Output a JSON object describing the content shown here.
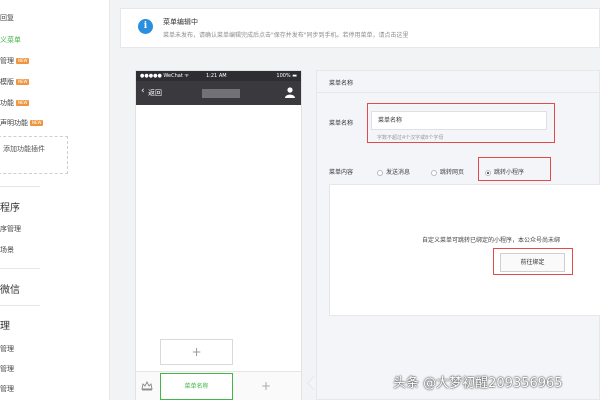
{
  "sidebar": {
    "items": [
      {
        "label": "回复",
        "active": false,
        "badge": ""
      },
      {
        "label": "义菜单",
        "active": true,
        "badge": ""
      },
      {
        "label": "管理",
        "active": false,
        "badge": "NEW"
      },
      {
        "label": "模版",
        "active": false,
        "badge": "NEW"
      },
      {
        "label": "功能",
        "active": false,
        "badge": "NEW"
      },
      {
        "label": "声明功能",
        "active": false,
        "badge": "NEW"
      }
    ],
    "plugin_label": "添加功能插件",
    "sections": [
      {
        "label": "程序",
        "items": [
          "序管理",
          "场景"
        ]
      },
      {
        "label": "微信",
        "items": []
      },
      {
        "label": "理",
        "items": [
          "管理",
          "管理",
          "管理"
        ]
      }
    ]
  },
  "info_bar": {
    "title": "菜单编辑中",
    "description": "菜单未发布，请确认菜单编辑完成后点击\"保存并发布\"同步到手机。若停用菜单，请点击这里"
  },
  "phone": {
    "carrier": "●●●●● WeChat ᯤ",
    "time": "1:21 AM",
    "battery": "100% ▬",
    "back_label": "返回",
    "menu_tab_label": "菜单名称",
    "add_sub_symbol": "+",
    "add_menu_symbol": "+"
  },
  "editor": {
    "title": "菜单名称",
    "name_label": "菜单名称",
    "name_value": "菜单名称",
    "name_hint": "字数不超过4个汉字或8个字母",
    "content_label": "菜单内容",
    "options": [
      {
        "label": "发送消息",
        "checked": false
      },
      {
        "label": "跳转网页",
        "checked": false
      },
      {
        "label": "跳转小程序",
        "checked": true
      }
    ],
    "content_note": "自定义菜单可跳转已绑定的小程序，本公众号尚未绑",
    "bind_button": "前往绑定"
  },
  "watermark": "头条 @大梦初醒209356965",
  "colors": {
    "accent_green": "#44b549",
    "info_blue": "#2b8fe0",
    "highlight_red": "#e04c4c",
    "new_badge": "#f0953f",
    "phone_header": "#3a3a3e"
  }
}
